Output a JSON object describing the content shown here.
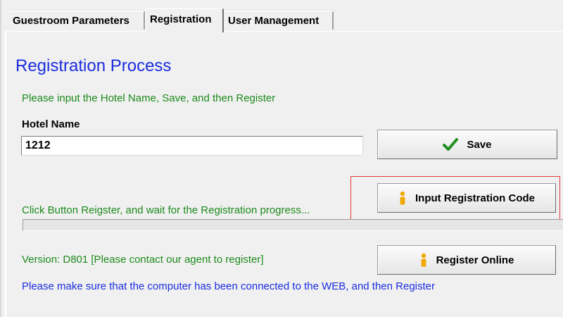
{
  "tabs": [
    {
      "label": "Guestroom Parameters",
      "active": false
    },
    {
      "label": "Registration",
      "active": true
    },
    {
      "label": "User Management",
      "active": false
    }
  ],
  "registration": {
    "title": "Registration Process",
    "instruction": "Please input the Hotel Name, Save, and then Register",
    "hotel_name_label": "Hotel Name",
    "hotel_name_value": "1212",
    "save_label": "Save",
    "input_code_label": "Input Registration Code",
    "progress_text": "Click Button Reigster, and wait for the Registration progress...",
    "progress_value": 0,
    "version_text": "Version: D801   [Please contact our agent to register]",
    "register_online_label": "Register Online",
    "web_notice": "Please make sure that the computer has been connected to the WEB, and then Register"
  },
  "icons": {
    "save": "checkmark-icon",
    "input_code": "info-person-icon",
    "register_online": "info-person-icon"
  },
  "colors": {
    "title_blue": "#1b2de0",
    "hint_green": "#1c8a1c",
    "highlight_red": "#e03c3c",
    "check_green": "#1f8f1f",
    "info_orange": "#f0a800"
  }
}
